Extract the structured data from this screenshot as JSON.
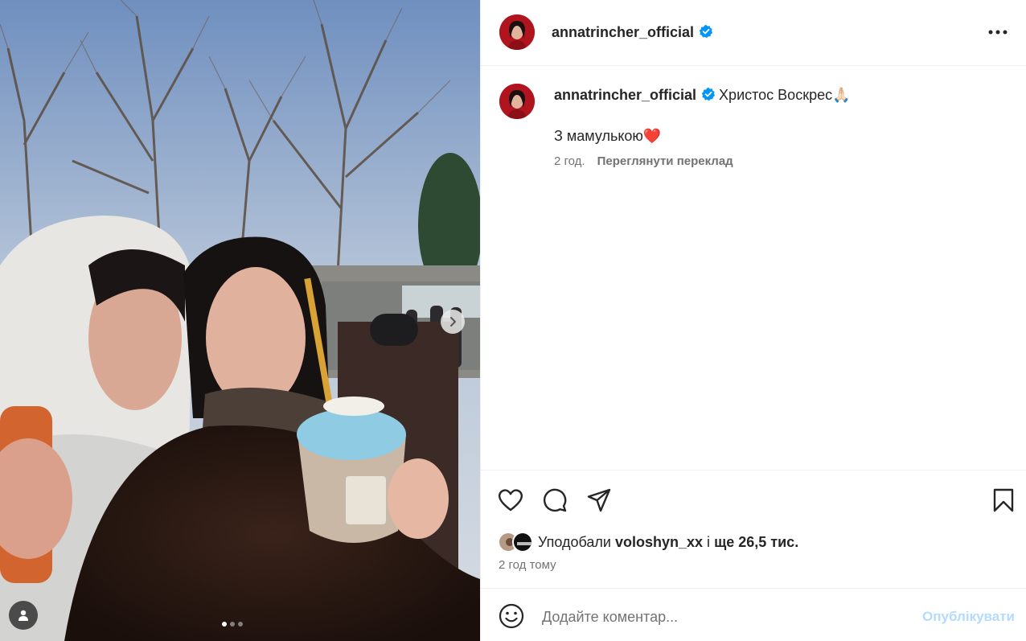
{
  "post": {
    "media": {
      "slide_count": 3,
      "active_slide": 1
    },
    "header": {
      "username": "annatrincher_official",
      "verified": true,
      "more_icon": "more-horizontal-icon"
    },
    "caption": {
      "username": "annatrincher_official",
      "text": "Христос Воскрес🙏🏻",
      "line2": "З мамулькою❤️",
      "time": "2 год.",
      "translate_label": "Переглянути переклад"
    },
    "actions": {
      "like_icon": "heart-icon",
      "comment_icon": "comment-icon",
      "share_icon": "share-icon",
      "save_icon": "bookmark-icon"
    },
    "likes": {
      "prefix": "Уподобали",
      "user": "voloshyn_xx",
      "connector": "і",
      "rest": "ще 26,5 тис."
    },
    "timestamp": "2 год тому",
    "comment": {
      "placeholder": "Додайте коментар...",
      "publish_label": "Опублікувати"
    }
  },
  "colors": {
    "verified_blue": "#0095f6",
    "publish_disabled": "#b3dbff",
    "secondary_text": "#737373",
    "divider": "#efefef"
  }
}
